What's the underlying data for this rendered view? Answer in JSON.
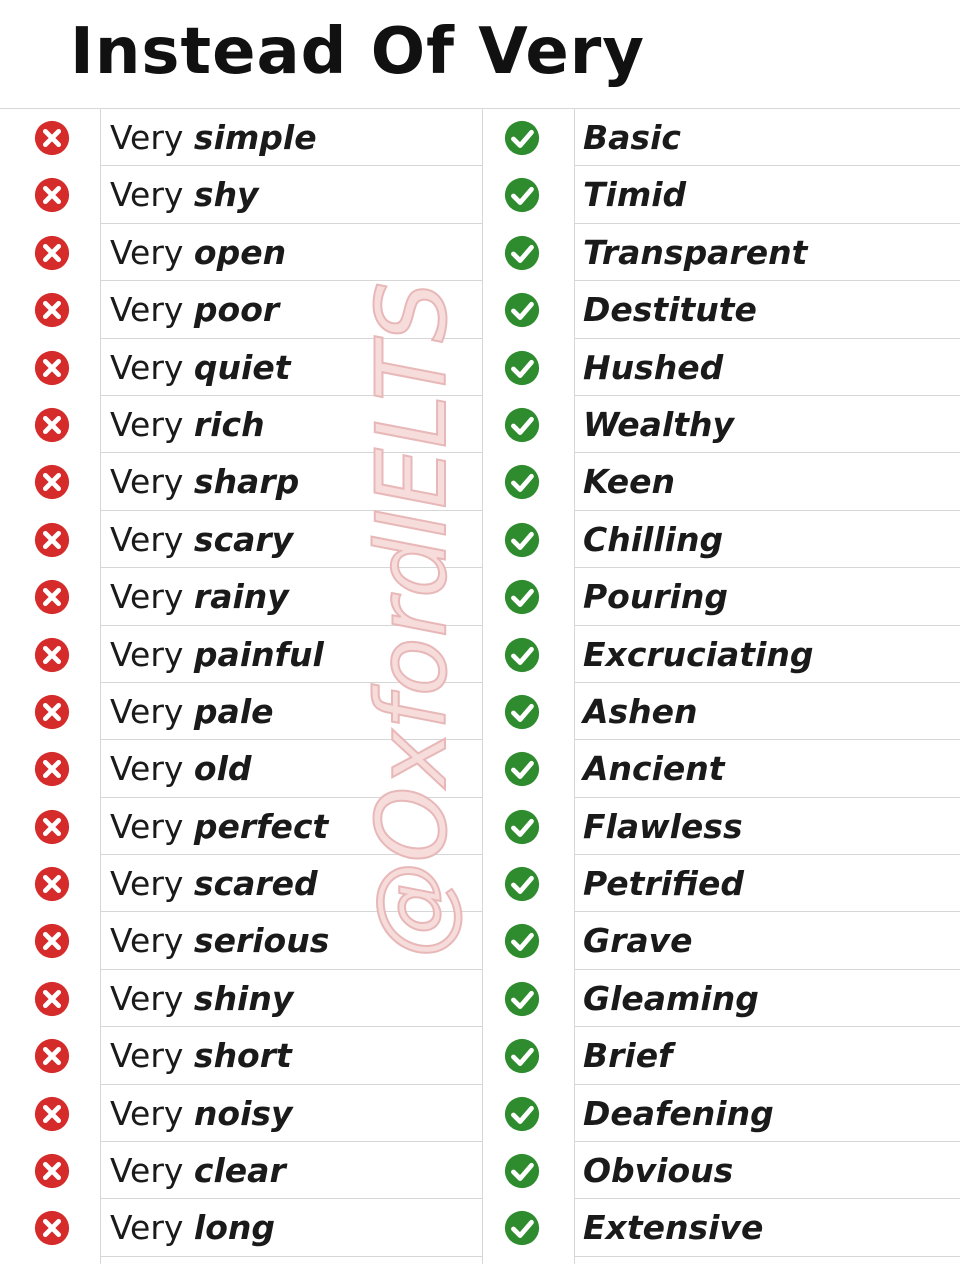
{
  "title": "Instead Of Very",
  "watermark": "@OxfordIELTS",
  "colors": {
    "wrong": "#d62b2b",
    "right": "#2e8b2e"
  },
  "icons": {
    "wrong": "x-icon",
    "right": "check-icon"
  },
  "rows": [
    {
      "prefix": "Very",
      "adjective": "simple",
      "alternative": "Basic"
    },
    {
      "prefix": "Very",
      "adjective": "shy",
      "alternative": "Timid"
    },
    {
      "prefix": "Very",
      "adjective": "open",
      "alternative": "Transparent"
    },
    {
      "prefix": "Very",
      "adjective": "poor",
      "alternative": "Destitute"
    },
    {
      "prefix": "Very",
      "adjective": "quiet",
      "alternative": "Hushed"
    },
    {
      "prefix": "Very",
      "adjective": "rich",
      "alternative": "Wealthy"
    },
    {
      "prefix": "Very",
      "adjective": "sharp",
      "alternative": "Keen"
    },
    {
      "prefix": "Very",
      "adjective": "scary",
      "alternative": "Chilling"
    },
    {
      "prefix": "Very",
      "adjective": "rainy",
      "alternative": "Pouring"
    },
    {
      "prefix": "Very",
      "adjective": "painful",
      "alternative": "Excruciating"
    },
    {
      "prefix": "Very",
      "adjective": "pale",
      "alternative": "Ashen"
    },
    {
      "prefix": "Very",
      "adjective": "old",
      "alternative": "Ancient"
    },
    {
      "prefix": "Very",
      "adjective": "perfect",
      "alternative": "Flawless"
    },
    {
      "prefix": "Very",
      "adjective": "scared",
      "alternative": "Petrified"
    },
    {
      "prefix": "Very",
      "adjective": "serious",
      "alternative": "Grave"
    },
    {
      "prefix": "Very",
      "adjective": "shiny",
      "alternative": "Gleaming"
    },
    {
      "prefix": "Very",
      "adjective": "short",
      "alternative": "Brief"
    },
    {
      "prefix": "Very",
      "adjective": "noisy",
      "alternative": "Deafening"
    },
    {
      "prefix": "Very",
      "adjective": "clear",
      "alternative": "Obvious"
    },
    {
      "prefix": "Very",
      "adjective": "long",
      "alternative": "Extensive"
    }
  ]
}
